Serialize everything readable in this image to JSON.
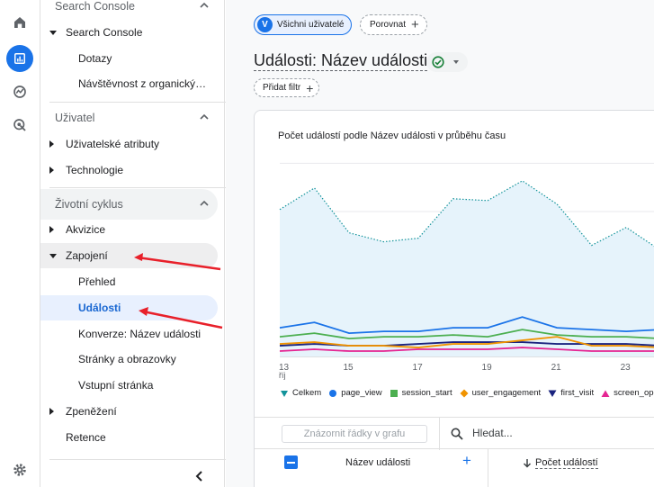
{
  "nav": {
    "sections": [
      {
        "title": "Search Console"
      },
      {
        "title": "Uživatel"
      },
      {
        "title": "Životní cyklus"
      }
    ],
    "items": {
      "search_console": "Search Console",
      "dotazy": "Dotazy",
      "navstevnost": "Návštěvnost z organických vyhledávání",
      "uzivatelske_atributy": "Uživatelské atributy",
      "technologie": "Technologie",
      "akvizice": "Akvizice",
      "zapojeni": "Zapojení",
      "prehled": "Přehled",
      "udalosti": "Události",
      "konverze": "Konverze: Název události",
      "stranky": "Stránky a obrazovky",
      "vstupni": "Vstupní stránka",
      "zpenezeni": "Zpeněžení",
      "retence": "Retence"
    }
  },
  "header": {
    "segment_badge": "V",
    "segment_label": "Všichni uživatelé",
    "compare_label": "Porovnat",
    "title": "Události: Název události",
    "add_filter": "Přidat filtr"
  },
  "chart_data": {
    "type": "line",
    "title": "Počet událostí podle Název události v průběhu času",
    "x_ticks": [
      {
        "label": "13",
        "sublabel": "říj"
      },
      {
        "label": "15"
      },
      {
        "label": "17"
      },
      {
        "label": "19"
      },
      {
        "label": "21"
      },
      {
        "label": "23"
      },
      {
        "label": "2"
      }
    ],
    "x": [
      13,
      14,
      15,
      16,
      17,
      18,
      19,
      20,
      21,
      22,
      23,
      24,
      25
    ],
    "series": [
      {
        "name": "Celkem",
        "values": [
          82,
          94,
          69,
          64,
          66,
          88,
          87,
          98,
          85,
          62,
          72,
          59,
          32
        ]
      },
      {
        "name": "page_view",
        "values": [
          16,
          19,
          13,
          14,
          14,
          16,
          16,
          22,
          16,
          15,
          14,
          15,
          9
        ]
      },
      {
        "name": "session_start",
        "values": [
          11,
          13,
          10,
          11,
          11,
          12,
          11,
          15,
          12,
          11,
          11,
          10,
          8
        ]
      },
      {
        "name": "user_engagement",
        "values": [
          7,
          8,
          6,
          6,
          5,
          7,
          7,
          9,
          11,
          6,
          6,
          5,
          4
        ]
      },
      {
        "name": "first_visit",
        "values": [
          6,
          7,
          6,
          6,
          7,
          8,
          8,
          8,
          7,
          7,
          7,
          6,
          5
        ]
      },
      {
        "name": "screen_ope",
        "values": [
          3,
          4,
          3,
          3,
          4,
          4,
          4,
          5,
          4,
          3,
          3,
          3,
          2
        ]
      }
    ],
    "colors": [
      "#12939a",
      "#1a73e8",
      "#4caf50",
      "#f09300",
      "#1a237e",
      "#e52592"
    ],
    "ylim": [
      0,
      110
    ]
  },
  "table": {
    "show_rows_placeholder": "Znázornit řádky v grafu",
    "search_placeholder": "Hledat...",
    "col_name": "Název události",
    "col_count": "Počet událostí"
  }
}
